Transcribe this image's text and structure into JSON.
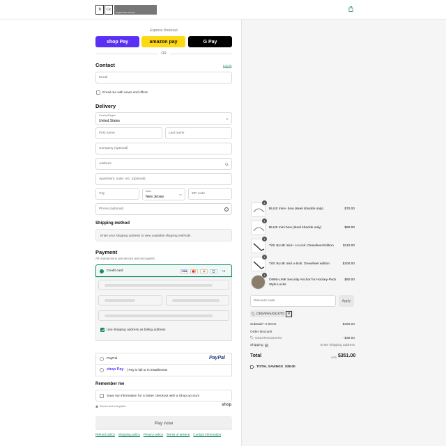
{
  "brand": {
    "box1": "Ti",
    "box2": "Gr",
    "tagline": "elegant bike security"
  },
  "express": {
    "title": "Express checkout",
    "shop_pay": "shop Pay",
    "amazon_pay": "amazon pay",
    "gpay": "G Pay",
    "or": "OR"
  },
  "contact": {
    "heading": "Contact",
    "login": "Log in",
    "email_placeholder": "Email",
    "news_label": "Email me with news and offers"
  },
  "delivery": {
    "heading": "Delivery",
    "country_label": "Country/Region",
    "country_value": "United States",
    "first_name": "First name",
    "last_name": "Last name",
    "company": "Company (optional)",
    "address": "Address",
    "apartment": "Apartment, suite, etc. (optional)",
    "city": "City",
    "state_label": "State",
    "state_value": "New Jersey",
    "zip": "ZIP code",
    "phone": "Phone (optional)"
  },
  "shipping_method": {
    "heading": "Shipping method",
    "message": "Enter your shipping address to view available shipping methods."
  },
  "payment": {
    "heading": "Payment",
    "subtitle": "All transactions are secure and encrypted.",
    "credit_card": "Credit card",
    "more_cards": "+5",
    "billing_label": "Use shipping address as billing address",
    "paypal": "PayPal",
    "paypal_logo": "PayPal",
    "shoppay_badge": "shop Pay",
    "shoppay_text": "| Pay in full or in installments"
  },
  "remember": {
    "heading": "Remember me",
    "label": "Save my information for a faster checkout with a Shop account",
    "secure": "Secure and encrypted",
    "shop": "shop"
  },
  "pay_now": "Pay now",
  "footer": [
    "Refund policy",
    "Shipping policy",
    "Privacy policy",
    "Terms of service",
    "Contact information"
  ],
  "order": {
    "items": [
      {
        "qty": "1",
        "name": "BLUE mini+ bow (steel shackle only)",
        "price": "$70.00"
      },
      {
        "qty": "1",
        "name": "BLUE mini bow (steel shackle only)",
        "price": "$60.00"
      },
      {
        "qty": "1",
        "name": "TiGr BLUE mini+ U-Lock: Onewheel Edition",
        "price": "$110.00"
      },
      {
        "qty": "1",
        "name": "TiGr BLUE mini u-lock: Onewheel edition",
        "price": "$100.00"
      },
      {
        "qty": "1",
        "name": "OMNI-LINK Security Anchor for Hockey-Puck Style Locks",
        "price": "$50.00"
      }
    ],
    "discount_placeholder": "Discount code",
    "apply": "Apply",
    "code_chip": "CESARAUGUSTO",
    "subtotal_label": "Subtotal • 5 items",
    "subtotal": "$390.00",
    "order_discount_label": "Order discount",
    "discount_code": "CESARAUGUSTO",
    "discount_amount": "- $39.00",
    "shipping_label": "Shipping",
    "shipping_value": "Enter shipping address",
    "total_label": "Total",
    "currency": "USD",
    "total": "$351.00",
    "savings_label": "TOTAL SAVINGS",
    "savings": "$39.00"
  },
  "colors": {
    "accent": "#1a8a6b",
    "shop_pay": "#5a31f4",
    "amazon": "#ffd814",
    "pay_now_bg": "#f0f0f0"
  }
}
